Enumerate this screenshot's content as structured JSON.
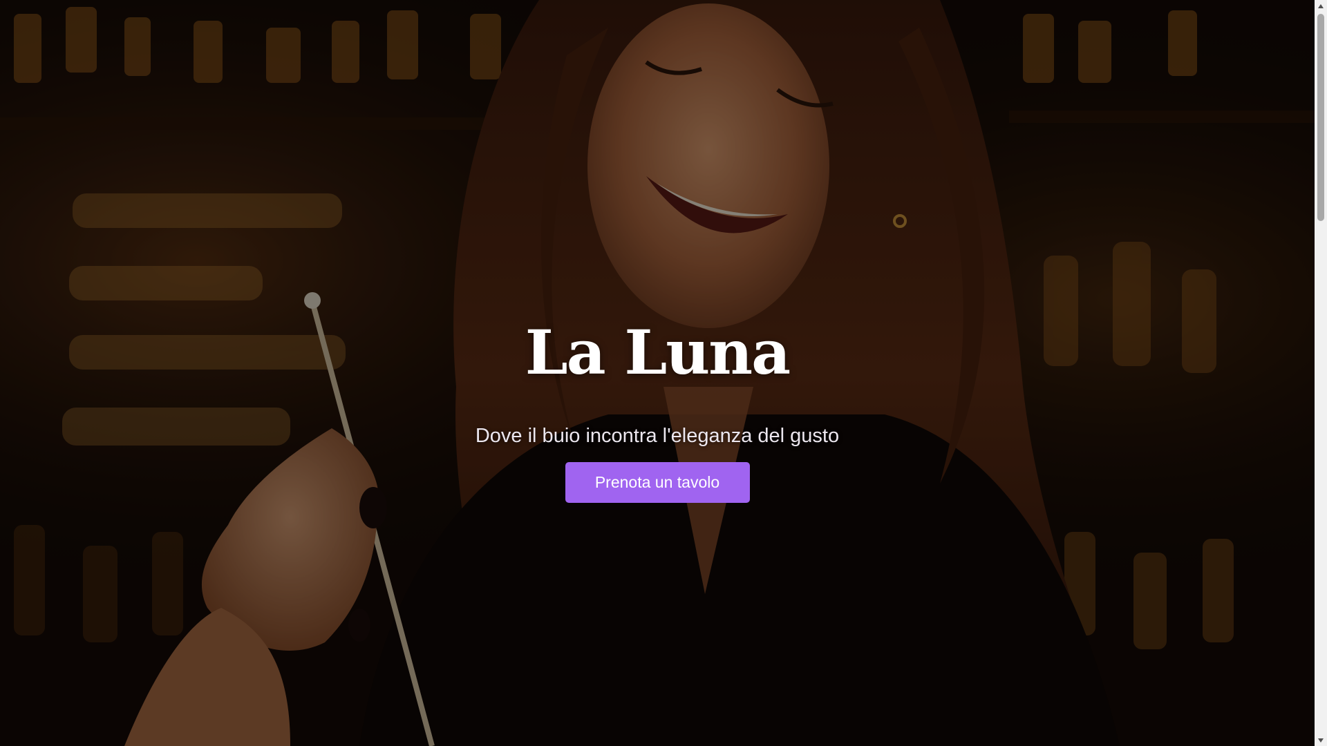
{
  "hero": {
    "title": "La Luna",
    "tagline": "Dove il buio incontra l'eleganza del gusto",
    "cta_label": "Prenota un tavolo",
    "background_image": "bartender-woman-laughing-photo"
  },
  "colors": {
    "accent": "#a064f0",
    "title": "#ffffff",
    "tagline": "#ece7ef",
    "background": "#140a06"
  },
  "scrollbar": {
    "up_icon": "scroll-up-arrow-icon",
    "down_icon": "scroll-down-arrow-icon"
  }
}
